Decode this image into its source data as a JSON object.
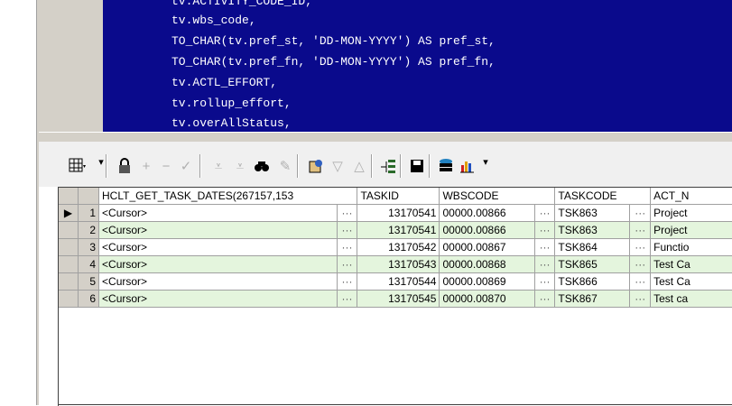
{
  "sql": {
    "lines": [
      "tv.ACTIVITY_CODE_ID,",
      "tv.wbs_code,",
      "TO_CHAR(tv.pref_st, 'DD-MON-YYYY') AS pref_st,",
      "TO_CHAR(tv.pref_fn, 'DD-MON-YYYY') AS pref_fn,",
      "tv.ACTL_EFFORT,",
      "tv.rollup_effort,",
      "tv.overAllStatus,"
    ]
  },
  "toolbar": {
    "icons": [
      "grid-menu-icon",
      "lock-icon",
      "add-icon",
      "delete-icon",
      "commit-icon",
      "filter-icon",
      "filter-clear-icon",
      "find-icon",
      "edit-icon",
      "record-icon",
      "sort-down-icon",
      "sort-up-icon",
      "explain-icon",
      "save-icon",
      "export-icon",
      "chart-icon"
    ],
    "dropdown_glyph": "▾"
  },
  "grid": {
    "columns": [
      "HCLT_GET_TASK_DATES(267157,153",
      "TASKID",
      "WBSCODE",
      "TASKCODE",
      "ACT_N"
    ],
    "ellipsis": "···",
    "rows": [
      {
        "n": "1",
        "cursor": "<Cursor>",
        "taskid": "13170541",
        "wbs": "00000.00866",
        "taskcode": "TSK863",
        "act": "Project"
      },
      {
        "n": "2",
        "cursor": "<Cursor>",
        "taskid": "13170541",
        "wbs": "00000.00866",
        "taskcode": "TSK863",
        "act": "Project"
      },
      {
        "n": "3",
        "cursor": "<Cursor>",
        "taskid": "13170542",
        "wbs": "00000.00867",
        "taskcode": "TSK864",
        "act": "Functio"
      },
      {
        "n": "4",
        "cursor": "<Cursor>",
        "taskid": "13170543",
        "wbs": "00000.00868",
        "taskcode": "TSK865",
        "act": "Test Ca"
      },
      {
        "n": "5",
        "cursor": "<Cursor>",
        "taskid": "13170544",
        "wbs": "00000.00869",
        "taskcode": "TSK866",
        "act": "Test Ca"
      },
      {
        "n": "6",
        "cursor": "<Cursor>",
        "taskid": "13170545",
        "wbs": "00000.00870",
        "taskcode": "TSK867",
        "act": "Test ca"
      }
    ],
    "current_row_marker": "▶"
  },
  "colors": {
    "editor_bg": "#0a0a8c",
    "alt_row": "#e4f5dd",
    "chrome": "#d4d0c8"
  }
}
